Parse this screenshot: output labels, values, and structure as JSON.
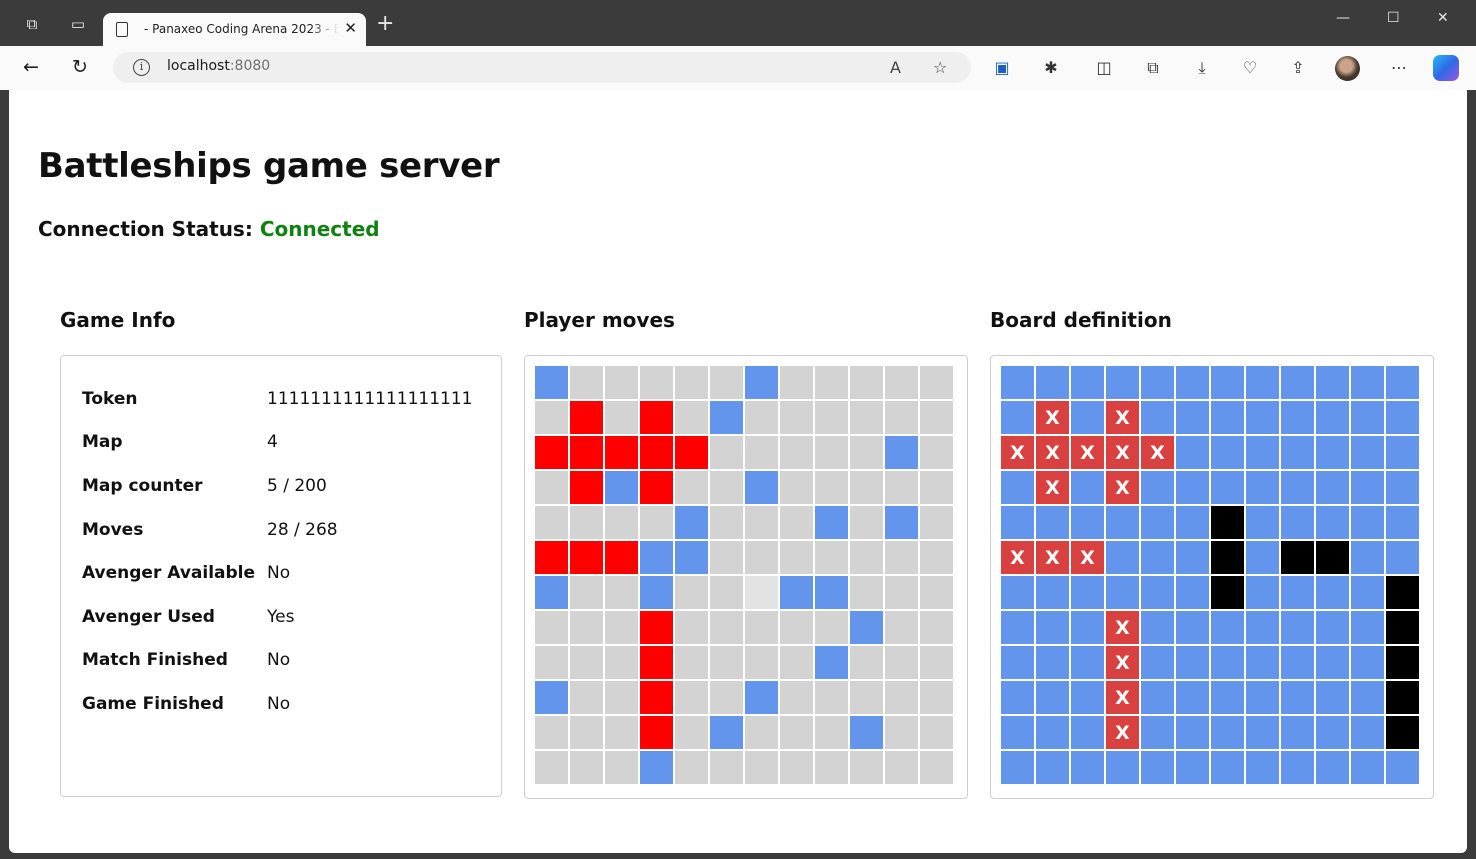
{
  "browser": {
    "tab_title": "- Panaxeo Coding Arena 2023 - Battleships",
    "url_host": "localhost",
    "url_port": ":8080"
  },
  "page": {
    "title": "Battleships game server",
    "status_label": "Connection Status:",
    "status_value": "Connected"
  },
  "game_info": {
    "title": "Game Info",
    "rows": [
      {
        "key": "Token",
        "value": "1111111111111111111"
      },
      {
        "key": "Map",
        "value": "4"
      },
      {
        "key": "Map counter",
        "value": "5 / 200"
      },
      {
        "key": "Moves",
        "value": "28 / 268"
      },
      {
        "key": "Avenger Available",
        "value": "No"
      },
      {
        "key": "Avenger Used",
        "value": "Yes"
      },
      {
        "key": "Match Finished",
        "value": "No"
      },
      {
        "key": "Game Finished",
        "value": "No"
      }
    ]
  },
  "player_moves": {
    "title": "Player moves",
    "legend": {
      "*": "unknown",
      "M": "miss",
      "H": "hit",
      "L": "last move"
    },
    "colors": {
      "*": "#d3d3d3",
      "M": "#6495ed",
      "H": "#ff0000",
      "L": "#e3e3e3"
    },
    "rows": [
      "M*****M*****",
      "*H*H*M******",
      "HHHHH*****M*",
      "*HMH**M*****",
      "****M***M*M*",
      "HHHMM*******",
      "M**M**LMM***",
      "***H*****M**",
      "***H****M***",
      "M**H**M*****",
      "***H*M***M**",
      "***M********"
    ]
  },
  "board_definition": {
    "title": "Board definition",
    "legend": {
      ".": "water",
      "X": "hit ship",
      "#": "ship"
    },
    "colors": {
      ".": "#6495ed",
      "X": "#d94141",
      "#": "#000000"
    },
    "hit_mark": "X",
    "rows": [
      "............",
      ".X.X........",
      "XXXXX.......",
      ".X.X........",
      "......#.....",
      "XXX...#.##..",
      "......#....#",
      "...X.......#",
      "...X.......#",
      "...X.......#",
      "...X.......#",
      "............"
    ]
  }
}
